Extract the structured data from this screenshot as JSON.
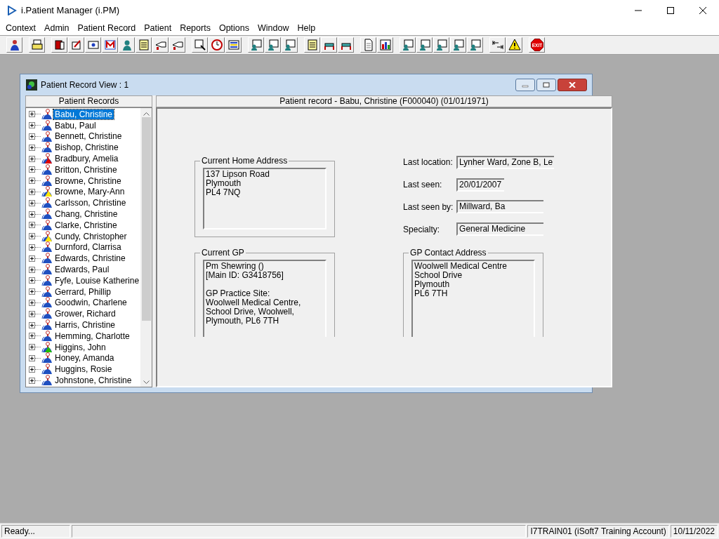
{
  "app": {
    "title": "i.Patient Manager (i.PM)"
  },
  "menu": [
    "Context",
    "Admin",
    "Patient Record",
    "Patient",
    "Reports",
    "Options",
    "Window",
    "Help"
  ],
  "toolbar": [
    [
      {
        "kind": "person"
      }
    ],
    [
      {
        "kind": "printer"
      }
    ],
    [
      {
        "kind": "book"
      },
      {
        "kind": "edit"
      },
      {
        "kind": "card"
      },
      {
        "kind": "letter"
      },
      {
        "kind": "doctor"
      },
      {
        "kind": "note"
      },
      {
        "kind": "hand"
      },
      {
        "kind": "hand"
      }
    ],
    [
      {
        "kind": "magnify"
      },
      {
        "kind": "clock"
      },
      {
        "kind": "list"
      }
    ],
    [
      {
        "kind": "screen"
      },
      {
        "kind": "screen"
      },
      {
        "kind": "screen"
      }
    ],
    [
      {
        "kind": "note"
      },
      {
        "kind": "bed"
      },
      {
        "kind": "bed"
      }
    ],
    [
      {
        "kind": "document"
      },
      {
        "kind": "chart"
      }
    ],
    [
      {
        "kind": "screen"
      },
      {
        "kind": "screen"
      },
      {
        "kind": "screen"
      },
      {
        "kind": "screen"
      },
      {
        "kind": "screen"
      }
    ],
    [
      {
        "kind": "arrows"
      },
      {
        "kind": "warning"
      }
    ],
    [
      {
        "kind": "exit",
        "label": "EXIT"
      }
    ]
  ],
  "child_window": {
    "title": "Patient Record View : 1",
    "tree": {
      "header": "Patient Records",
      "items": [
        {
          "name": "Babu, Christine",
          "selected": true
        },
        {
          "name": "Babu, Paul",
          "selected": false
        },
        {
          "name": "Bennett, Christine",
          "selected": false
        },
        {
          "name": "Bishop, Christine",
          "selected": false
        },
        {
          "name": "Bradbury, Amelia",
          "selected": false,
          "color": "#e00000"
        },
        {
          "name": "Britton, Christine",
          "selected": false
        },
        {
          "name": "Browne, Christine",
          "selected": false
        },
        {
          "name": "Browne, Mary-Ann",
          "selected": false,
          "color": "#ffe600"
        },
        {
          "name": "Carlsson, Christine",
          "selected": false
        },
        {
          "name": "Chang, Christine",
          "selected": false
        },
        {
          "name": "Clarke, Christine",
          "selected": false
        },
        {
          "name": "Cundy, Christopher",
          "selected": false,
          "color": "#ffe600"
        },
        {
          "name": "Durnford, Clarrisa",
          "selected": false
        },
        {
          "name": "Edwards, Christine",
          "selected": false
        },
        {
          "name": "Edwards, Paul",
          "selected": false
        },
        {
          "name": "Fyfe, Louise Katherine",
          "selected": false
        },
        {
          "name": "Gerrard, Phillip",
          "selected": false
        },
        {
          "name": "Goodwin, Charlene",
          "selected": false
        },
        {
          "name": "Grower, Richard",
          "selected": false
        },
        {
          "name": "Harris, Christine",
          "selected": false
        },
        {
          "name": "Hemming, Charlotte",
          "selected": false
        },
        {
          "name": "Higgins, John",
          "selected": false,
          "color": "#22c000"
        },
        {
          "name": "Honey, Amanda",
          "selected": false
        },
        {
          "name": "Huggins, Rosie",
          "selected": false
        },
        {
          "name": "Johnstone, Christine",
          "selected": false
        }
      ]
    },
    "record": {
      "header": "Patient record - Babu, Christine (F000040) (01/01/1971)",
      "home_address": {
        "legend": "Current Home Address",
        "paragraphs": [
          [
            "137 Lipson Road",
            "Plymouth",
            "PL4 7NQ"
          ]
        ]
      },
      "details": [
        {
          "label": "Last location:",
          "value": "Lynher Ward, Zone B, Le"
        },
        {
          "label": "Last seen:",
          "value": "20/01/2007"
        },
        {
          "label": "Last seen by:",
          "value": "Millward, Ba"
        },
        {
          "label": "Specialty:",
          "value": "General Medicine"
        }
      ],
      "current_gp": {
        "legend": "Current GP",
        "paragraphs": [
          [
            "Pm Shewring ()",
            "[Main ID: G3418756]"
          ],
          [
            "GP Practice Site:",
            "Woolwell Medical Centre, School Drive, Woolwell, Plymouth, PL6 7TH"
          ]
        ]
      },
      "gp_contact": {
        "legend": "GP Contact Address",
        "paragraphs": [
          [
            "Woolwell Medical Centre",
            "School Drive",
            "Plymouth",
            "PL6 7TH"
          ]
        ]
      }
    }
  },
  "status_bar": {
    "message": "Ready...",
    "account": "I7TRAIN01 (iSoft7 Training Account)",
    "date": "10/11/2022"
  }
}
